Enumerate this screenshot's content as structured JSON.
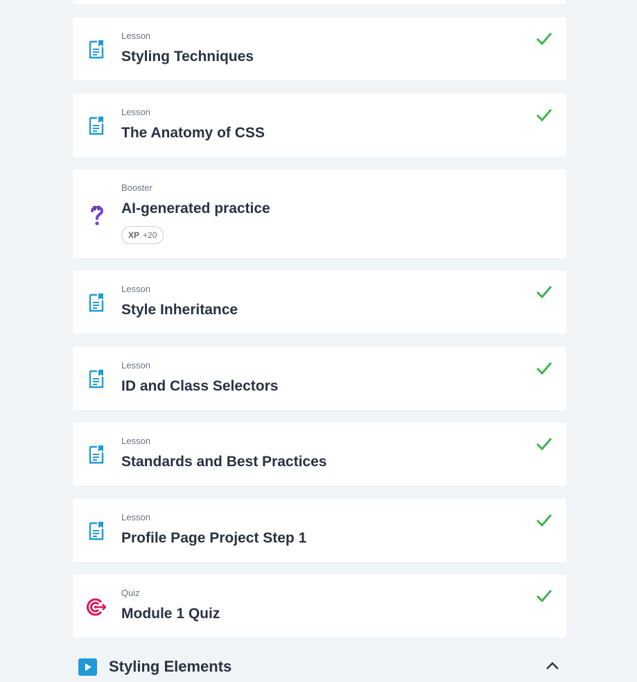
{
  "items": [
    {
      "kind": "Lesson",
      "title": "Styling Techniques",
      "icon": "lesson-doc-icon",
      "completed": true
    },
    {
      "kind": "Lesson",
      "title": "The Anatomy of CSS",
      "icon": "lesson-doc-icon",
      "completed": true
    },
    {
      "kind": "Booster",
      "title": "AI-generated practice",
      "icon": "question-mark-icon",
      "completed": false,
      "xp_label": "XP",
      "xp_value": "+20"
    },
    {
      "kind": "Lesson",
      "title": "Style Inheritance",
      "icon": "lesson-doc-icon",
      "completed": true
    },
    {
      "kind": "Lesson",
      "title": "ID and Class Selectors",
      "icon": "lesson-doc-icon",
      "completed": true
    },
    {
      "kind": "Lesson",
      "title": "Standards and Best Practices",
      "icon": "lesson-doc-icon",
      "completed": true
    },
    {
      "kind": "Lesson",
      "title": "Profile Page Project Step 1",
      "icon": "lesson-doc-icon",
      "completed": true
    },
    {
      "kind": "Quiz",
      "title": "Module 1 Quiz",
      "icon": "target-icon",
      "completed": true
    }
  ],
  "next_section": {
    "title": "Styling Elements",
    "expanded": true
  },
  "colors": {
    "background": "#f1f4f7",
    "card": "#ffffff",
    "lesson_icon": "#1f9ad6",
    "check": "#3fb34f",
    "quiz_icon": "#e0115f",
    "booster_icon": "#7b3fd6",
    "text": "#293243",
    "muted": "#6a7282"
  }
}
